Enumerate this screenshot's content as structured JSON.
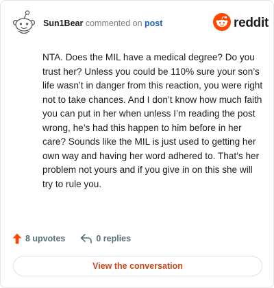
{
  "header": {
    "username": "Sun1Bear",
    "action_text": "commented on",
    "post_link": "post"
  },
  "brand": {
    "wordmark": "reddit",
    "icon": "reddit-alien-icon",
    "color": "#ff4500"
  },
  "avatar": {
    "icon": "snoo-avatar-icon"
  },
  "comment": {
    "text": "NTA. Does the MIL have a medical degree? Do you trust her? Unless you could be 110% sure your son’s life wasn’t in danger from this reaction, you were right not to take chances. And I don’t know how much faith you can put in her when unless I’m reading the post wrong, he’s had this happen to him before in her care? Sounds like the MIL is just used to getting her own way and having her word adhered to. That’s her problem not yours and if you give in on this she will try to rule you."
  },
  "actions": {
    "upvotes_label": "8 upvotes",
    "upvote_icon": "arrow-up-icon",
    "replies_label": "0 replies",
    "reply_icon": "reply-arrow-icon"
  },
  "cta": {
    "label": "View the conversation",
    "color": "#c8461a"
  }
}
